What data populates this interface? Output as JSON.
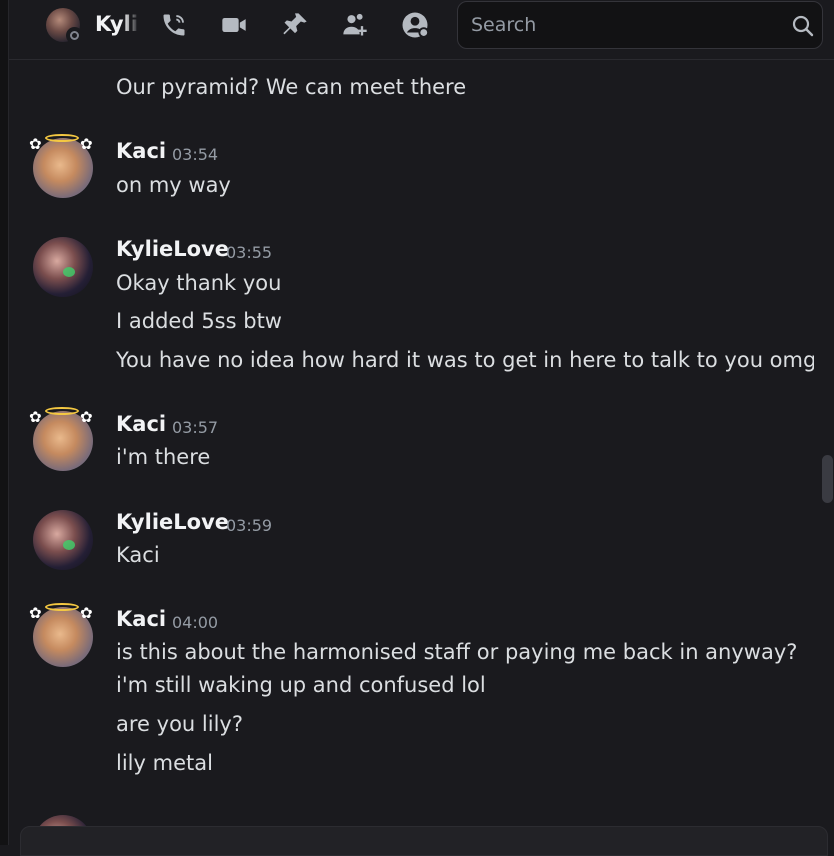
{
  "header": {
    "name": "KylieLove",
    "search_placeholder": "Search"
  },
  "messages": {
    "prev_line": "Our pyramid? We can meet there",
    "groups": [
      {
        "author": "Kaci",
        "time": "03:54",
        "lines": [
          "on my way"
        ]
      },
      {
        "author": "KylieLove",
        "time": "03:55",
        "lines": [
          "Okay thank you",
          "I added 5ss btw",
          "You have no idea how hard it was to get in here to talk to you omg"
        ]
      },
      {
        "author": "Kaci",
        "time": "03:57",
        "lines": [
          "i'm there"
        ]
      },
      {
        "author": "KylieLove",
        "time": "03:59",
        "lines": [
          "Kaci"
        ]
      },
      {
        "author": "Kaci",
        "time": "04:00",
        "lines": [
          "is this about the harmonised staff or paying me back in anyway?",
          "i'm still waking up and confused lol",
          "are you lily?",
          "lily metal"
        ]
      }
    ]
  },
  "colors": {
    "background": "#1a1a1e",
    "text": "#dbdee1",
    "muted": "#949ba4",
    "halo": "#f4c842"
  }
}
